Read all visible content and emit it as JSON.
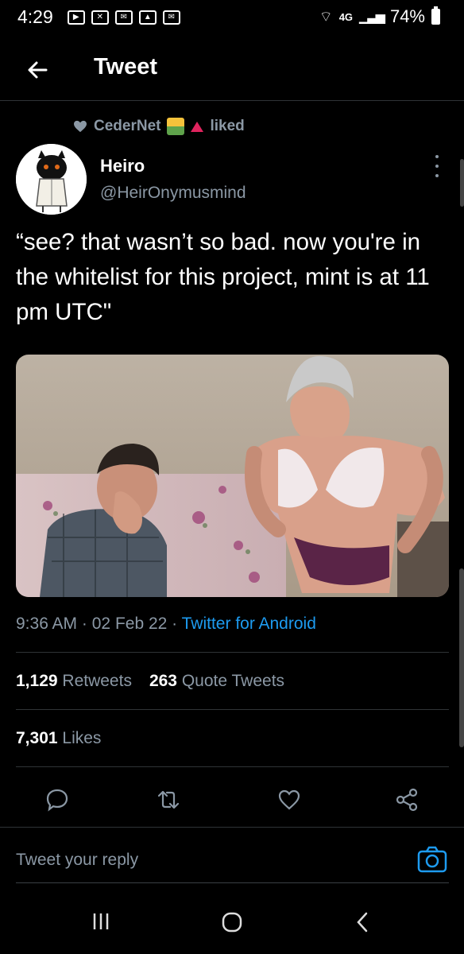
{
  "status_bar": {
    "time": "4:29",
    "network": "4G",
    "battery": "74%"
  },
  "header": {
    "title": "Tweet"
  },
  "social_context": {
    "user": "CederNet",
    "action": "liked"
  },
  "tweet": {
    "author_name": "Heiro",
    "author_handle": "@HeirOnymusmind",
    "text": "“see? that wasn’t so bad. now you're in the whitelist for this project, mint is at 11 pm UTC\"",
    "time": "9:36 AM",
    "date": "02 Feb 22",
    "source": "Twitter for Android",
    "separator": "·"
  },
  "stats": {
    "retweets_count": "1,129",
    "retweets_label": "Retweets",
    "quotes_count": "263",
    "quotes_label": "Quote Tweets",
    "likes_count": "7,301",
    "likes_label": "Likes"
  },
  "reply": {
    "placeholder": "Tweet your reply"
  },
  "colors": {
    "background": "#000000",
    "text_primary": "#e7e9ea",
    "text_secondary": "#8b98a5",
    "accent": "#1d9bf0",
    "divider": "#2f3336"
  },
  "icons": {
    "back": "arrow-left-icon",
    "more": "more-vertical-icon",
    "reply": "comment-icon",
    "retweet": "retweet-icon",
    "like": "heart-icon",
    "share": "share-icon",
    "camera": "camera-icon"
  }
}
